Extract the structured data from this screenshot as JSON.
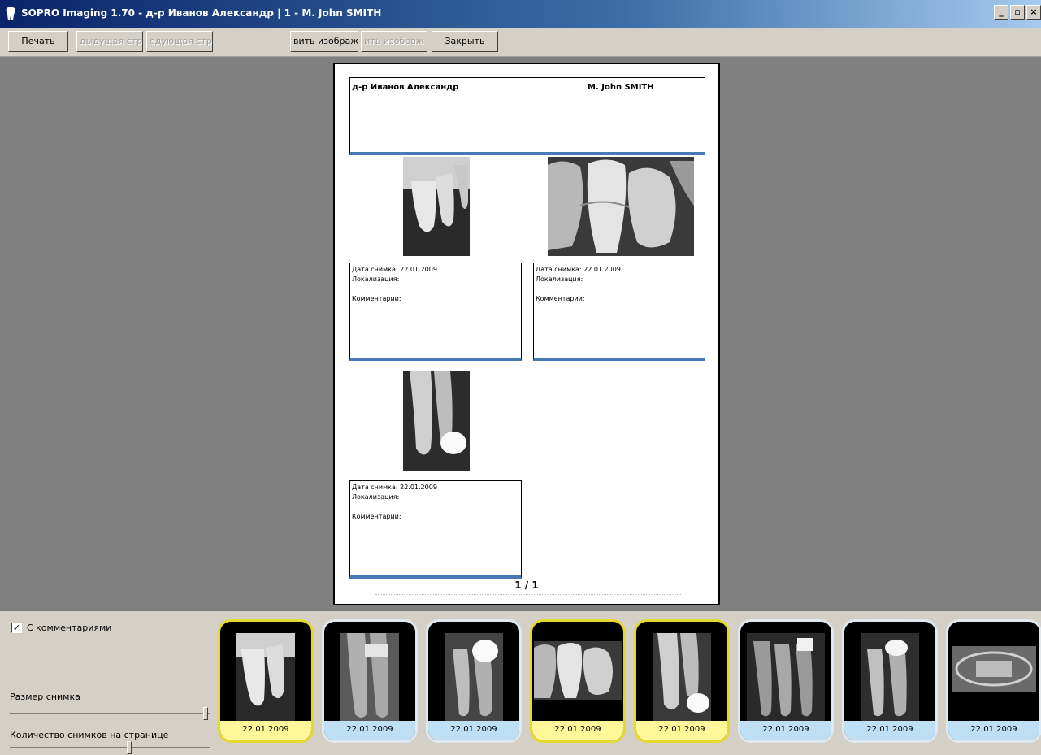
{
  "window": {
    "title": "SOPRO Imaging 1.70 - д-р Иванов Александр | 1 - M. John SMITH",
    "min": "_",
    "max": "▫",
    "close": "×"
  },
  "toolbar": {
    "print": "Печать",
    "prev_page": "дыдущая стра",
    "next_page": "едующая стра",
    "add_image": "вить изображ",
    "remove_image": "ить изображ",
    "close": "Закрыть"
  },
  "page": {
    "doctor": "д-р Иванов Александр",
    "patient": "M. John SMITH",
    "entries": [
      {
        "date_label": "Дата снимка:",
        "date": "22.01.2009",
        "location_label": "Локализация:",
        "comment_label": "Комментарии:"
      },
      {
        "date_label": "Дата снимка:",
        "date": "22.01.2009",
        "location_label": "Локализация:",
        "comment_label": "Комментарии:"
      },
      {
        "date_label": "Дата снимка:",
        "date": "22.01.2009",
        "location_label": "Локализация:",
        "comment_label": "Комментарии:"
      }
    ],
    "page_number": "1 / 1"
  },
  "options": {
    "with_comments": "С комментариями",
    "with_comments_checked": true,
    "image_size_label": "Размер снимка",
    "images_per_page_label": "Количество снимков на странице"
  },
  "thumbnails": [
    {
      "date": "22.01.2009",
      "selected": true
    },
    {
      "date": "22.01.2009",
      "selected": false
    },
    {
      "date": "22.01.2009",
      "selected": false
    },
    {
      "date": "22.01.2009",
      "selected": true
    },
    {
      "date": "22.01.2009",
      "selected": true
    },
    {
      "date": "22.01.2009",
      "selected": false
    },
    {
      "date": "22.01.2009",
      "selected": false
    },
    {
      "date": "22.01.2009",
      "selected": false
    }
  ],
  "colors": {
    "selected_border": "#e6d832",
    "selected_date_bg": "#fff89a",
    "normal_date_bg": "#bfe0f4",
    "accent_line": "#4a7ab5"
  }
}
